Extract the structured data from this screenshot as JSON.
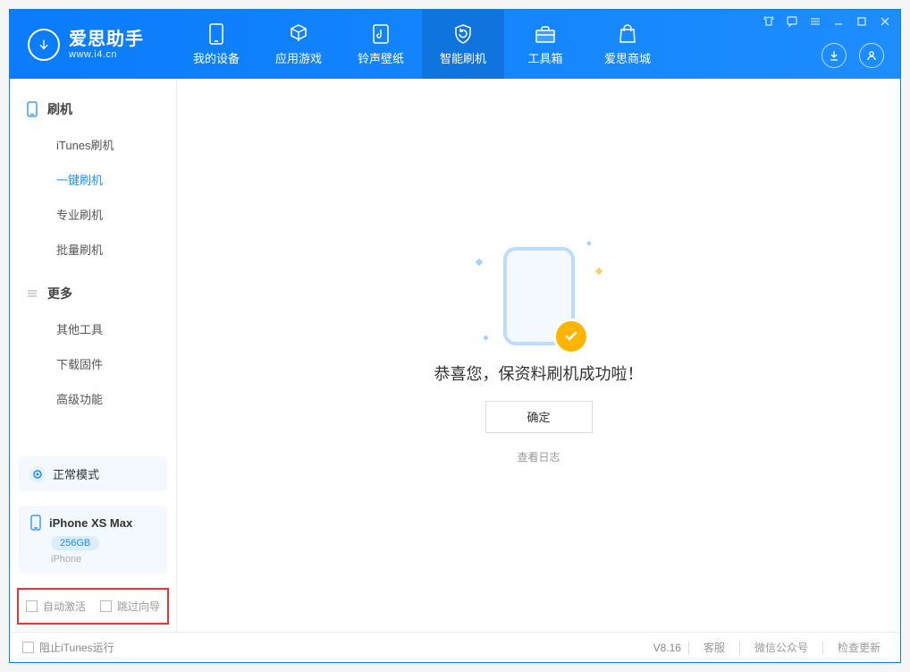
{
  "app": {
    "title": "爱思助手",
    "url": "www.i4.cn"
  },
  "nav": {
    "items": [
      {
        "label": "我的设备"
      },
      {
        "label": "应用游戏"
      },
      {
        "label": "铃声壁纸"
      },
      {
        "label": "智能刷机"
      },
      {
        "label": "工具箱"
      },
      {
        "label": "爱思商城"
      }
    ]
  },
  "sidebar": {
    "section1_title": "刷机",
    "section1_items": [
      {
        "label": "iTunes刷机"
      },
      {
        "label": "一键刷机"
      },
      {
        "label": "专业刷机"
      },
      {
        "label": "批量刷机"
      }
    ],
    "section2_title": "更多",
    "section2_items": [
      {
        "label": "其他工具"
      },
      {
        "label": "下载固件"
      },
      {
        "label": "高级功能"
      }
    ],
    "device_status": "正常模式",
    "device_name": "iPhone XS Max",
    "device_capacity": "256GB",
    "device_type": "iPhone",
    "cb_auto_activate": "自动激活",
    "cb_skip_guide": "跳过向导"
  },
  "main": {
    "success_text": "恭喜您，保资料刷机成功啦！",
    "ok_button": "确定",
    "view_log": "查看日志"
  },
  "status": {
    "cb_block_itunes": "阻止iTunes运行",
    "version": "V8.16",
    "links": {
      "service": "客服",
      "wechat": "微信公众号",
      "update": "检查更新"
    }
  }
}
